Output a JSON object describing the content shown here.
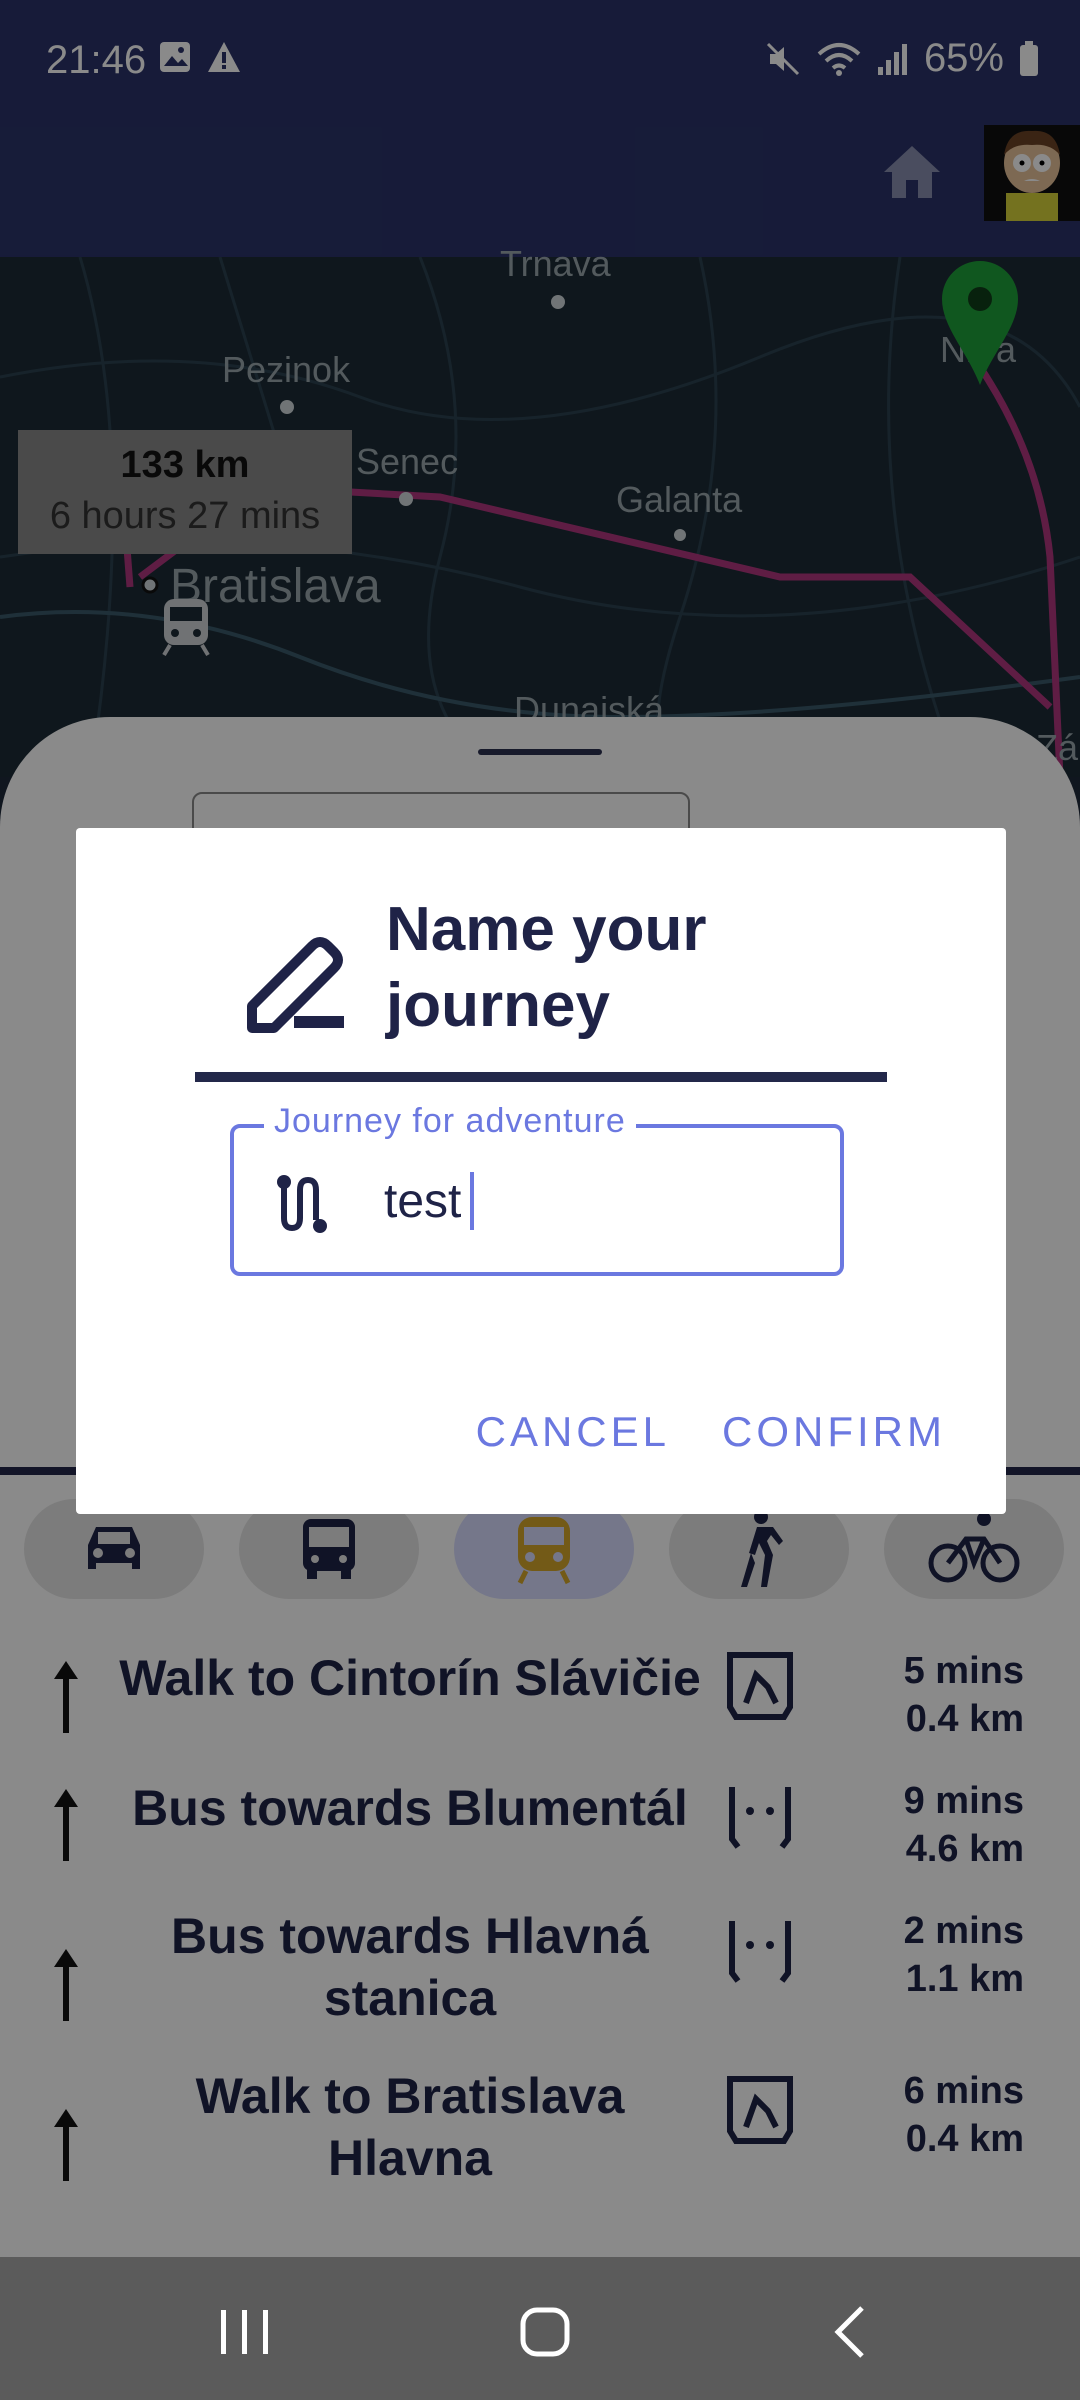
{
  "status_bar": {
    "time": "21:46",
    "battery": "65%"
  },
  "map": {
    "labels": [
      "Trnava",
      "Pezinok",
      "Senec",
      "Galanta",
      "Bratislava",
      "Dunajská",
      "Nitra",
      "Zá"
    ],
    "summary": {
      "distance": "133 km",
      "duration": "6 hours 27 mins"
    }
  },
  "dialog": {
    "title": "Name your journey",
    "field": {
      "label": "Journey for adventure",
      "value": "test"
    },
    "cancel_label": "CANCEL",
    "confirm_label": "CONFIRM"
  },
  "modes": [
    "car",
    "bus",
    "train",
    "walk",
    "bike"
  ],
  "active_mode": "train",
  "steps": [
    {
      "text": "Walk to Cintorín Slávičie",
      "time": "5 mins",
      "distance": "0.4 km",
      "icon": "walk-route-icon"
    },
    {
      "text": "Bus towards Blumentál",
      "time": "9 mins",
      "distance": "4.6 km",
      "icon": "bus-route-icon"
    },
    {
      "text": "Bus towards Hlavná stanica",
      "time": "2 mins",
      "distance": "1.1 km",
      "icon": "bus-route-icon"
    },
    {
      "text": "Walk to Bratislava Hlavna",
      "time": "6 mins",
      "distance": "0.4 km",
      "icon": "walk-route-icon"
    }
  ],
  "colors": {
    "app_bar": "#2b3369",
    "accent": "#6b78e0",
    "text_dark": "#1f2347",
    "route": "#b0377f"
  }
}
